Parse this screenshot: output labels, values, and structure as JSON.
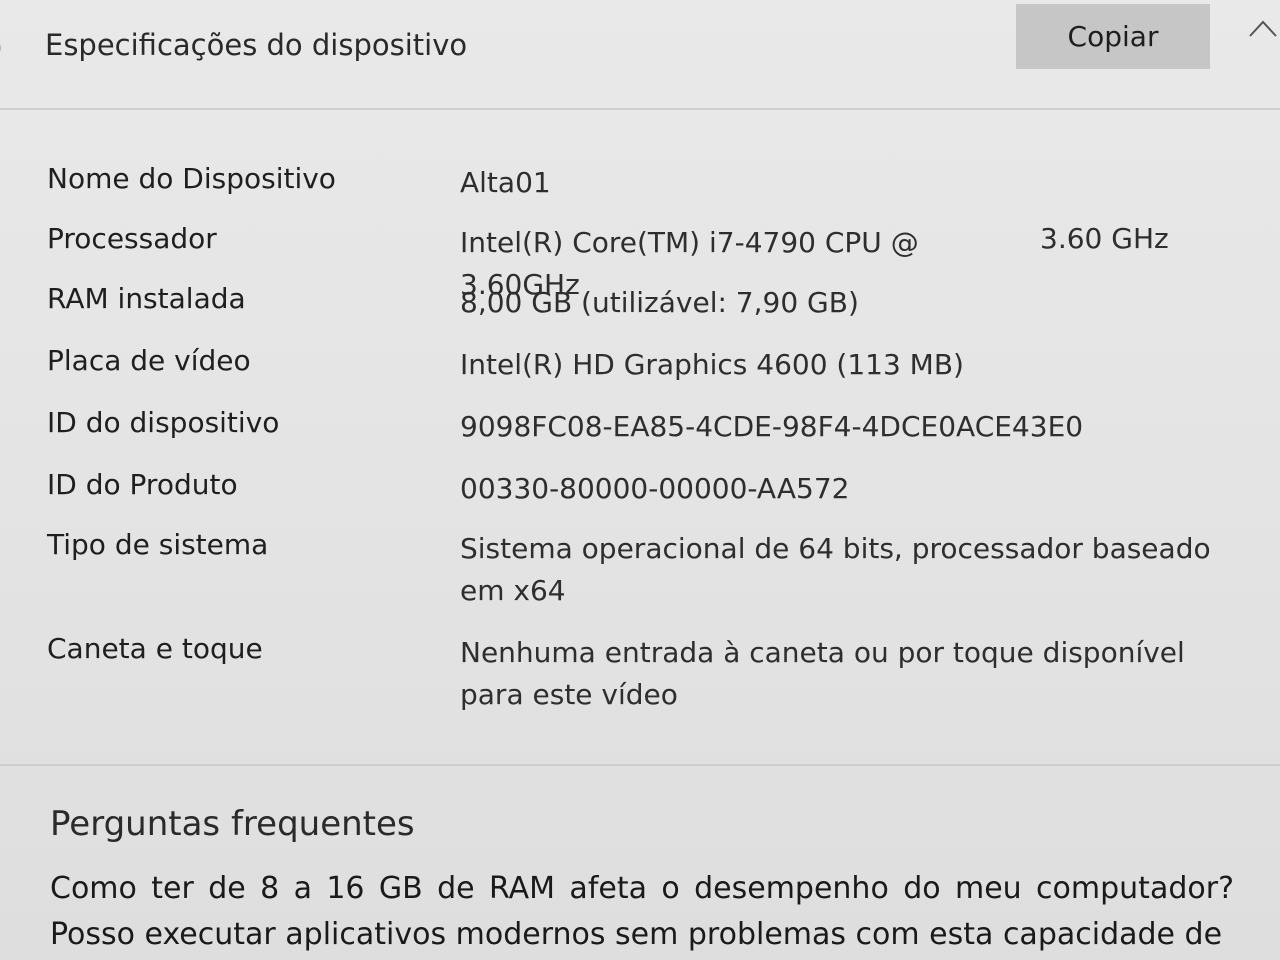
{
  "header": {
    "title": "Especificações do dispositivo",
    "copy_label": "Copiar"
  },
  "specs": [
    {
      "label": "Nome do Dispositivo",
      "value": "Alta01"
    },
    {
      "label": "Processador",
      "value": "Intel(R) Core(TM) i7-4790 CPU @ 3.60GHz",
      "extra": "3.60 GHz"
    },
    {
      "label": "RAM instalada",
      "value": "8,00 GB (utilizável: 7,90 GB)"
    },
    {
      "label": "Placa de vídeo",
      "value": "Intel(R) HD Graphics 4600 (113 MB)"
    },
    {
      "label": "ID do dispositivo",
      "value": "9098FC08-EA85-4CDE-98F4-4DCE0ACE43E0"
    },
    {
      "label": "ID do Produto",
      "value": "00330-80000-00000-AA572"
    },
    {
      "label": "Tipo de sistema",
      "value": "Sistema operacional de 64 bits, processador baseado em x64"
    },
    {
      "label": "Caneta e toque",
      "value": "Nenhuma entrada à caneta ou por toque disponível para este vídeo"
    }
  ],
  "faq": {
    "heading": "Perguntas frequentes",
    "question": "Como ter de 8 a 16 GB de RAM afeta o desempenho do meu computador? Posso executar aplicativos modernos sem problemas com esta capacidade de"
  },
  "icons": {
    "expander": "collapse-glyph",
    "chevron": "chevron-up-icon"
  }
}
